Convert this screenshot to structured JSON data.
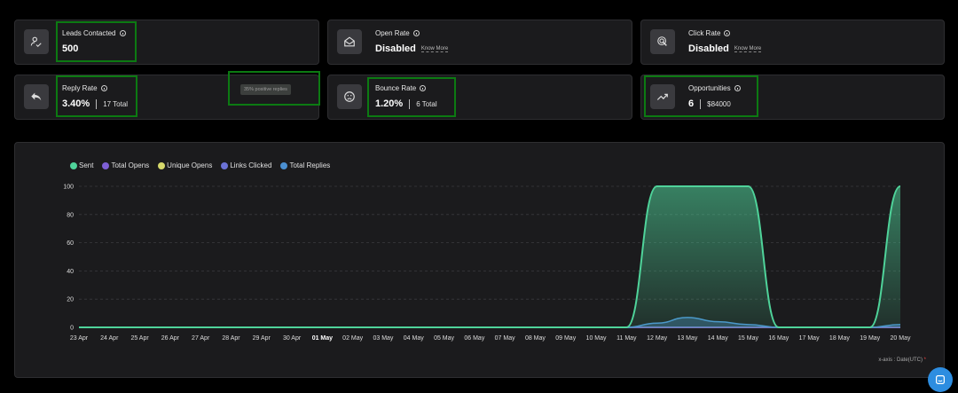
{
  "stats": {
    "leads_contacted": {
      "label": "Leads Contacted",
      "value": "500",
      "icon": "user-check-icon"
    },
    "open_rate": {
      "label": "Open Rate",
      "value": "Disabled",
      "link": "Know More",
      "icon": "envelope-open-icon"
    },
    "click_rate": {
      "label": "Click Rate",
      "value": "Disabled",
      "link": "Know More",
      "icon": "cursor-click-icon"
    },
    "reply_rate": {
      "label": "Reply Rate",
      "value": "3.40%",
      "sub": "17 Total",
      "badge": "35% positive replies",
      "icon": "reply-icon"
    },
    "bounce_rate": {
      "label": "Bounce Rate",
      "value": "1.20%",
      "sub": "6 Total",
      "icon": "sad-face-icon"
    },
    "opportunities": {
      "label": "Opportunities",
      "value": "6",
      "sub": "$84000",
      "icon": "trending-up-icon"
    }
  },
  "chart_data": {
    "type": "area",
    "categories": [
      "23 Apr",
      "24 Apr",
      "25 Apr",
      "26 Apr",
      "27 Apr",
      "28 Apr",
      "29 Apr",
      "30 Apr",
      "01 May",
      "02 May",
      "03 May",
      "04 May",
      "05 May",
      "06 May",
      "07 May",
      "08 May",
      "09 May",
      "10 May",
      "11 May",
      "12 May",
      "13 May",
      "14 May",
      "15 May",
      "16 May",
      "17 May",
      "18 May",
      "19 May",
      "20 May"
    ],
    "yticks": [
      0,
      20,
      40,
      60,
      80,
      100
    ],
    "ylim": [
      0,
      100
    ],
    "grid": true,
    "legend_position": "top-left",
    "series": [
      {
        "name": "Sent",
        "color": "#4fd39a",
        "values": [
          0,
          0,
          0,
          0,
          0,
          0,
          0,
          0,
          0,
          0,
          0,
          0,
          0,
          0,
          0,
          0,
          0,
          0,
          0,
          100,
          100,
          100,
          100,
          0,
          0,
          0,
          0,
          100
        ]
      },
      {
        "name": "Total Opens",
        "color": "#7e5fd6",
        "values": [
          0,
          0,
          0,
          0,
          0,
          0,
          0,
          0,
          0,
          0,
          0,
          0,
          0,
          0,
          0,
          0,
          0,
          0,
          0,
          0,
          0,
          0,
          0,
          0,
          0,
          0,
          0,
          0
        ]
      },
      {
        "name": "Unique Opens",
        "color": "#d6d96b",
        "values": [
          0,
          0,
          0,
          0,
          0,
          0,
          0,
          0,
          0,
          0,
          0,
          0,
          0,
          0,
          0,
          0,
          0,
          0,
          0,
          0,
          0,
          0,
          0,
          0,
          0,
          0,
          0,
          0
        ]
      },
      {
        "name": "Links Clicked",
        "color": "#6b72d6",
        "values": [
          0,
          0,
          0,
          0,
          0,
          0,
          0,
          0,
          0,
          0,
          0,
          0,
          0,
          0,
          0,
          0,
          0,
          0,
          0,
          0,
          0,
          0,
          0,
          0,
          0,
          0,
          0,
          0
        ]
      },
      {
        "name": "Total Replies",
        "color": "#4a8fd1",
        "values": [
          0,
          0,
          0,
          0,
          0,
          0,
          0,
          0,
          0,
          0,
          0,
          0,
          0,
          0,
          0,
          0,
          0,
          0,
          0,
          3,
          7,
          4,
          2,
          0,
          0,
          0,
          0,
          2
        ]
      }
    ],
    "bold_tick": "01 May",
    "x_note": "x-axis : Date(UTC)",
    "x_note_mark": "*"
  }
}
